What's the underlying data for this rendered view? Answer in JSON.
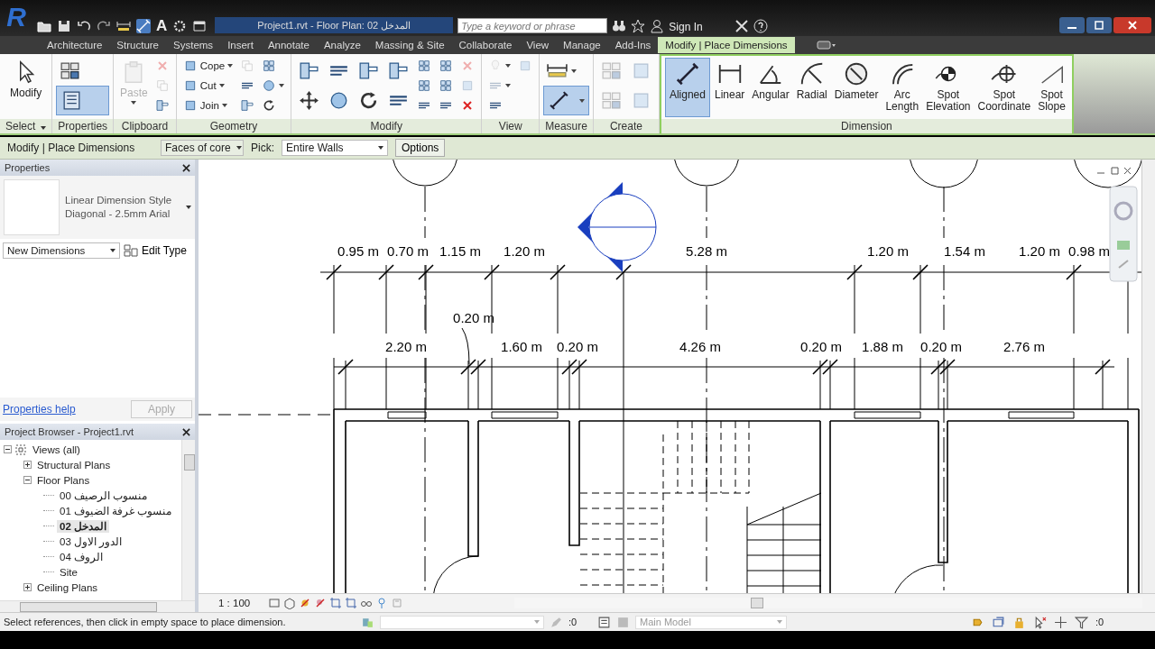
{
  "title_bar": {
    "app_letter": "R",
    "text_tool": "A",
    "title": "Project1.rvt - Floor Plan: 02 المدخل",
    "search": {
      "placeholder": "Type a keyword or phrase"
    },
    "sign_in": "Sign In"
  },
  "ribbon": {
    "tabs": [
      {
        "label": "Architecture",
        "selected": false
      },
      {
        "label": "Structure",
        "selected": false
      },
      {
        "label": "Systems",
        "selected": false
      },
      {
        "label": "Insert",
        "selected": false
      },
      {
        "label": "Annotate",
        "selected": false
      },
      {
        "label": "Analyze",
        "selected": false
      },
      {
        "label": "Massing & Site",
        "selected": false
      },
      {
        "label": "Collaborate",
        "selected": false
      },
      {
        "label": "View",
        "selected": false
      },
      {
        "label": "Manage",
        "selected": false
      },
      {
        "label": "Add-Ins",
        "selected": false
      },
      {
        "label": "Modify | Place Dimensions",
        "selected": true
      }
    ],
    "panels": [
      {
        "title": "Select",
        "menu": true,
        "tools": [
          {
            "kind": "large",
            "label": "Modify",
            "selected": false,
            "disabled": false,
            "caret": false
          }
        ]
      },
      {
        "title": "Properties",
        "menu": false,
        "tools": [
          {
            "kind": "medium",
            "selected": false,
            "disabled": false,
            "caret": false
          },
          {
            "kind": "medium",
            "selected": true,
            "disabled": false,
            "caret": false
          }
        ]
      },
      {
        "title": "Clipboard",
        "menu": false,
        "tools": [
          {
            "kind": "large",
            "label": "Paste",
            "selected": false,
            "disabled": true,
            "caret": true
          },
          {
            "kind": "small",
            "selected": false,
            "disabled": true,
            "caret": false
          },
          {
            "kind": "small",
            "selected": false,
            "disabled": true,
            "caret": false
          },
          {
            "kind": "small",
            "selected": false,
            "disabled": false,
            "caret": false
          }
        ]
      },
      {
        "title": "Geometry",
        "menu": false,
        "tools": [
          {
            "kind": "small",
            "label": "Cope",
            "selected": false,
            "disabled": false,
            "caret": true
          },
          {
            "kind": "small",
            "label": "Cut",
            "selected": false,
            "disabled": false,
            "caret": true
          },
          {
            "kind": "small",
            "label": "Join",
            "selected": false,
            "disabled": false,
            "caret": true
          },
          {
            "kind": "small",
            "selected": false,
            "disabled": true,
            "caret": false
          },
          {
            "kind": "small",
            "selected": false,
            "disabled": false,
            "caret": false
          },
          {
            "kind": "small",
            "selected": false,
            "disabled": false,
            "caret": false
          },
          {
            "kind": "small",
            "selected": false,
            "disabled": false,
            "caret": false
          },
          {
            "kind": "small",
            "selected": false,
            "disabled": false,
            "caret": true
          },
          {
            "kind": "small",
            "selected": false,
            "disabled": false,
            "caret": false
          }
        ]
      },
      {
        "title": "Modify",
        "menu": false,
        "tools": [
          {
            "kind": "medium",
            "selected": false,
            "disabled": false,
            "caret": false
          },
          {
            "kind": "medium",
            "selected": false,
            "disabled": false,
            "caret": false
          },
          {
            "kind": "medium",
            "selected": false,
            "disabled": false,
            "caret": false
          },
          {
            "kind": "medium",
            "selected": false,
            "disabled": false,
            "caret": false
          },
          {
            "kind": "medium",
            "selected": false,
            "disabled": false,
            "caret": false
          },
          {
            "kind": "medium",
            "selected": false,
            "disabled": false,
            "caret": false
          },
          {
            "kind": "medium",
            "selected": false,
            "disabled": false,
            "caret": false
          },
          {
            "kind": "medium",
            "selected": false,
            "disabled": false,
            "caret": false
          },
          {
            "kind": "small",
            "selected": false,
            "disabled": false,
            "caret": false
          },
          {
            "kind": "small",
            "selected": false,
            "disabled": false,
            "caret": false
          },
          {
            "kind": "small",
            "selected": false,
            "disabled": false,
            "caret": false
          },
          {
            "kind": "small",
            "selected": false,
            "disabled": false,
            "caret": false
          },
          {
            "kind": "small",
            "selected": false,
            "disabled": false,
            "caret": false
          },
          {
            "kind": "small",
            "selected": false,
            "disabled": false,
            "caret": false
          },
          {
            "kind": "small",
            "selected": false,
            "disabled": true,
            "caret": false
          },
          {
            "kind": "small",
            "selected": false,
            "disabled": true,
            "caret": false
          },
          {
            "kind": "small",
            "selected": false,
            "disabled": false,
            "caret": false
          }
        ]
      },
      {
        "title": "View",
        "menu": false,
        "tools": [
          {
            "kind": "small",
            "selected": false,
            "disabled": true,
            "caret": true
          },
          {
            "kind": "small",
            "selected": false,
            "disabled": true,
            "caret": true
          },
          {
            "kind": "small",
            "selected": false,
            "disabled": false,
            "caret": false
          },
          {
            "kind": "small",
            "selected": false,
            "disabled": true,
            "caret": false
          }
        ]
      },
      {
        "title": "Measure",
        "menu": false,
        "tools": [
          {
            "kind": "medium",
            "selected": false,
            "disabled": false,
            "caret": true
          },
          {
            "kind": "medium",
            "selected": true,
            "disabled": false,
            "caret": true
          }
        ]
      },
      {
        "title": "Create",
        "menu": false,
        "tools": [
          {
            "kind": "medium",
            "selected": false,
            "disabled": true,
            "caret": false
          },
          {
            "kind": "medium",
            "selected": false,
            "disabled": true,
            "caret": false
          },
          {
            "kind": "medium",
            "selected": false,
            "disabled": true,
            "caret": false
          },
          {
            "kind": "medium",
            "selected": false,
            "disabled": true,
            "caret": false
          }
        ]
      },
      {
        "title": "Dimension",
        "menu": false,
        "tools": [
          {
            "kind": "large",
            "label": "Aligned",
            "selected": true,
            "disabled": false,
            "caret": false
          },
          {
            "kind": "large",
            "label": "Linear",
            "selected": false,
            "disabled": false,
            "caret": false
          },
          {
            "kind": "large",
            "label": "Angular",
            "selected": false,
            "disabled": false,
            "caret": false
          },
          {
            "kind": "large",
            "label": "Radial",
            "selected": false,
            "disabled": false,
            "caret": false
          },
          {
            "kind": "large",
            "label": "Diameter",
            "selected": false,
            "disabled": false,
            "caret": false
          },
          {
            "kind": "large",
            "label": "Arc Length",
            "selected": false,
            "disabled": false,
            "caret": false
          },
          {
            "kind": "large",
            "label": "Spot Elevation",
            "selected": false,
            "disabled": false,
            "caret": false
          },
          {
            "kind": "large",
            "label": "Spot Coordinate",
            "selected": false,
            "disabled": false,
            "caret": false
          },
          {
            "kind": "large",
            "label": "Spot Slope",
            "selected": false,
            "disabled": false,
            "caret": false
          }
        ]
      }
    ]
  },
  "options_bar": {
    "context": "Modify | Place Dimensions",
    "reference": "Faces of core",
    "pick_label": "Pick:",
    "pick": "Entire Walls",
    "options_button": "Options"
  },
  "properties": {
    "title": "Properties",
    "type_family": "Linear Dimension Style",
    "type_name": "Diagonal - 2.5mm Arial",
    "filter": "New Dimensions",
    "edit_type": "Edit Type",
    "help_link": "Properties help",
    "apply": "Apply"
  },
  "project_browser": {
    "title": "Project Browser - Project1.rvt",
    "tree": [
      {
        "label": "Views (all)",
        "expanded": true,
        "selected": false,
        "children": [
          {
            "label": "Structural Plans",
            "expanded": false,
            "selected": false
          },
          {
            "label": "Floor Plans",
            "expanded": true,
            "selected": false,
            "children": [
              {
                "label": "00 منسوب الرصيف",
                "selected": false
              },
              {
                "label": "01 منسوب غرفة الضيوف",
                "selected": false
              },
              {
                "label": "02 المدخل",
                "selected": true
              },
              {
                "label": "03 الدور الاول",
                "selected": false
              },
              {
                "label": "04 الروف",
                "selected": false
              },
              {
                "label": "Site",
                "selected": false
              }
            ]
          },
          {
            "label": "Ceiling Plans",
            "expanded": false,
            "selected": false
          }
        ]
      }
    ]
  },
  "canvas": {
    "dimension_strings": [
      {
        "labels": [
          "0.95 m",
          "0.70 m",
          "1.15 m",
          "1.20 m",
          "5.28 m",
          "1.20 m",
          "1.54 m",
          "1.20 m",
          "0.98 m"
        ]
      },
      {
        "labels": [
          "2.20 m",
          "0.20 m",
          "1.60 m",
          "0.20 m",
          "4.26 m",
          "0.20 m",
          "1.88 m",
          "0.20 m",
          "2.76 m"
        ]
      }
    ]
  },
  "view_bar": {
    "scale": "1 : 100"
  },
  "status_bar": {
    "message": "Select references, then click in empty space to place dimension.",
    "count": ":0",
    "model": "Main Model",
    "filter_count": ":0"
  }
}
